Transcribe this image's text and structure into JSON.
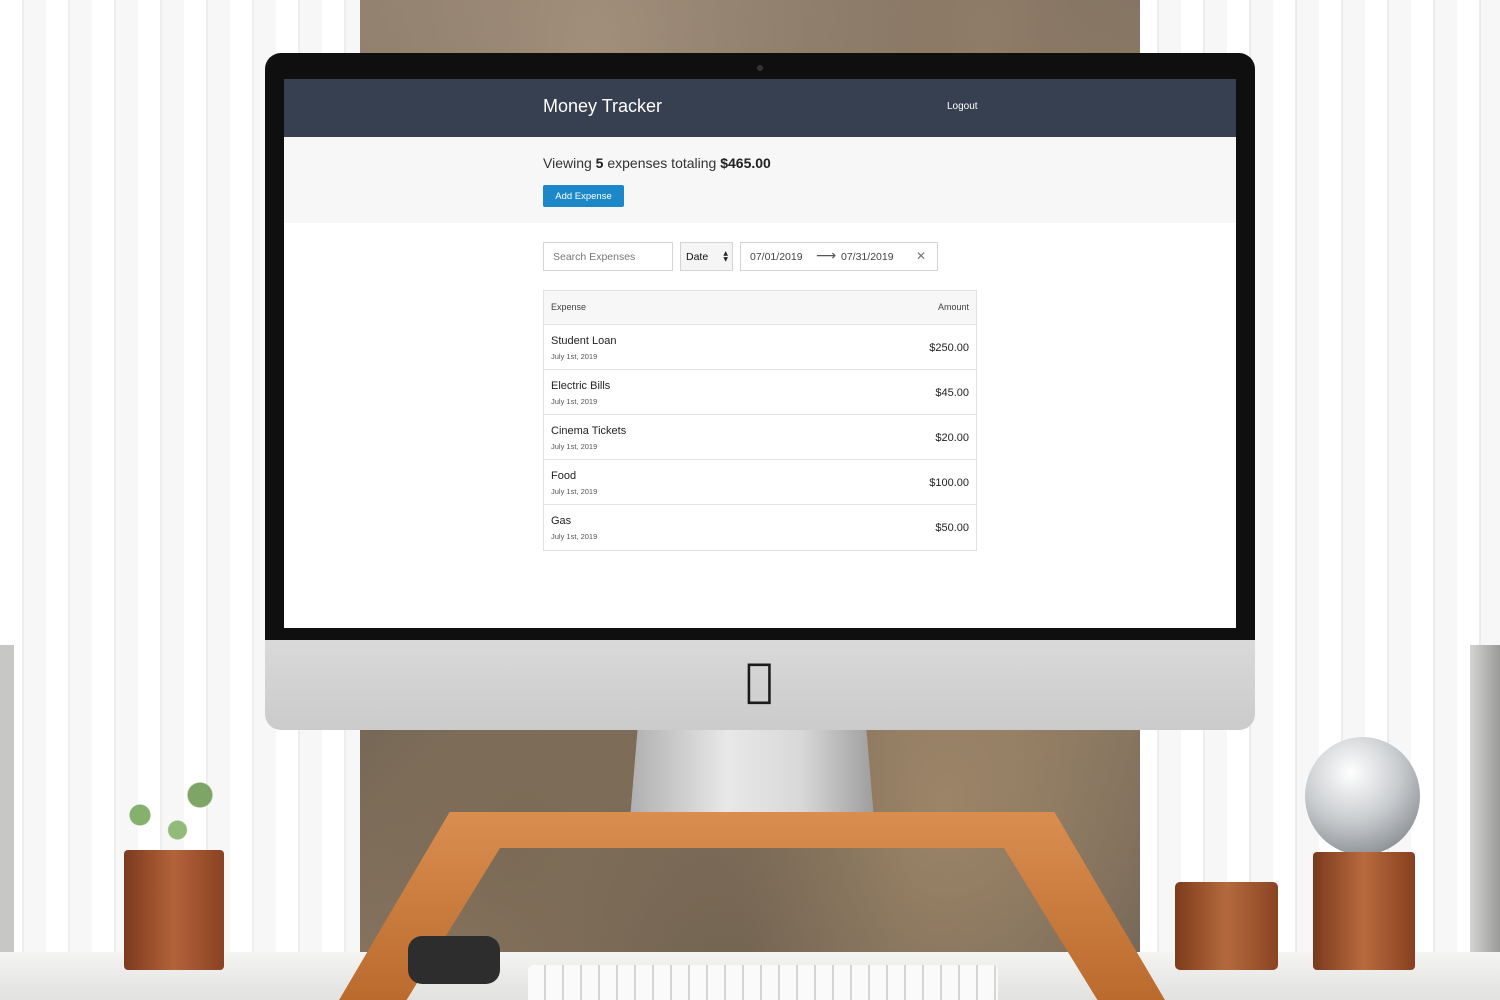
{
  "app": {
    "title": "Money Tracker",
    "logout_label": "Logout",
    "accent_color": "#1c88c7",
    "header_color": "#364051"
  },
  "summary": {
    "prefix": "Viewing",
    "count": "5",
    "middle": "expenses totaling",
    "total": "$465.00",
    "add_button_label": "Add Expense"
  },
  "filters": {
    "search_placeholder": "Search Expenses",
    "search_value": "",
    "sort_selected": "Date",
    "date_start": "07/01/2019",
    "date_end": "07/31/2019"
  },
  "table": {
    "headers": {
      "expense": "Expense",
      "amount": "Amount"
    },
    "rows": [
      {
        "name": "Student Loan",
        "date": "July 1st, 2019",
        "amount": "$250.00"
      },
      {
        "name": "Electric Bills",
        "date": "July 1st, 2019",
        "amount": "$45.00"
      },
      {
        "name": "Cinema Tickets",
        "date": "July 1st, 2019",
        "amount": "$20.00"
      },
      {
        "name": "Food",
        "date": "July 1st, 2019",
        "amount": "$100.00"
      },
      {
        "name": "Gas",
        "date": "July 1st, 2019",
        "amount": "$50.00"
      }
    ]
  },
  "icons": {
    "sort_caret": "sort-caret-icon",
    "date_arrow": "arrow-right-icon",
    "date_clear": "close-icon",
    "brand": "apple-logo-icon"
  }
}
